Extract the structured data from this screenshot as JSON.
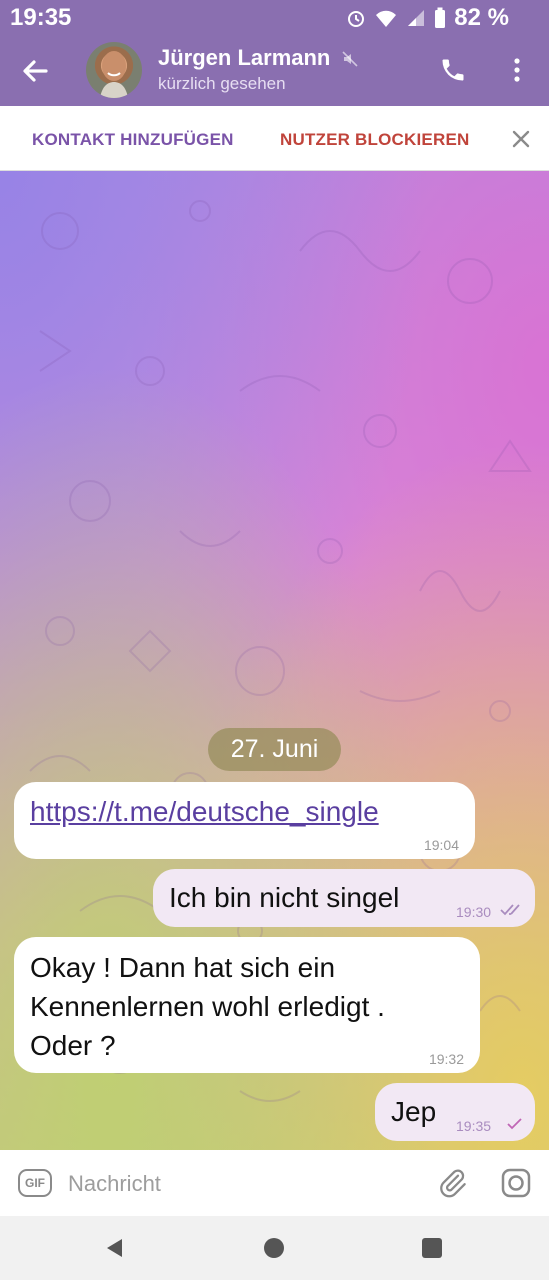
{
  "status_bar": {
    "time": "19:35",
    "battery": "82 %"
  },
  "chat_header": {
    "contact_name": "Jürgen Larmann",
    "last_seen": "kürzlich gesehen"
  },
  "actions": {
    "add_contact": "KONTAKT HINZUFÜGEN",
    "block_user": "NUTZER BLOCKIEREN"
  },
  "date_separator": "27. Juni",
  "messages": [
    {
      "direction": "incoming",
      "text": "https://t.me/deutsche_single",
      "time": "19:04"
    },
    {
      "direction": "outgoing",
      "text": "Ich bin nicht singel",
      "time": "19:30",
      "status": "read"
    },
    {
      "direction": "incoming",
      "lines": [
        "Okay  ! Dann hat sich ein",
        "Kennenlernen wohl erledigt  .",
        "Oder ?"
      ],
      "time": "19:32"
    },
    {
      "direction": "outgoing",
      "text": "Jep",
      "time": "19:35",
      "status": "sent"
    }
  ],
  "composer": {
    "gif_label": "GIF",
    "placeholder": "Nachricht"
  },
  "colors": {
    "header": "#8a6fb0",
    "accent": "#7a53a8",
    "block": "#c0443b",
    "outgoing_bubble": "#f2e8f4"
  },
  "icons": [
    "back-arrow-icon",
    "mute-icon",
    "phone-icon",
    "more-vertical-icon",
    "close-icon",
    "read-checks-icon",
    "sent-check-icon",
    "paperclip-icon",
    "camera-icon",
    "nav-back-icon",
    "nav-home-icon",
    "nav-recents-icon"
  ]
}
